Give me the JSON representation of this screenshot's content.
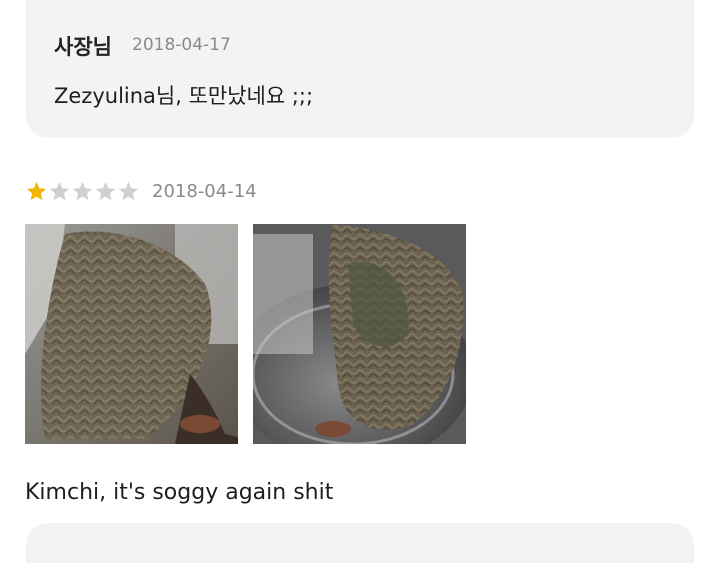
{
  "owner_reply": {
    "author": "사장님",
    "date": "2018-04-17",
    "text": "Zezyulina님, 또만났네요 ;;;"
  },
  "review": {
    "rating": 1,
    "rating_max": 5,
    "date": "2018-04-14",
    "photos": [
      {
        "icon": "soggy-noodles-photo"
      },
      {
        "icon": "soggy-noodles-in-container-photo"
      }
    ],
    "text": "Kimchi, it's soggy again shit"
  },
  "colors": {
    "star_filled": "#f2b705",
    "star_empty": "#d0d0d0",
    "card_bg": "#f3f3f3"
  }
}
